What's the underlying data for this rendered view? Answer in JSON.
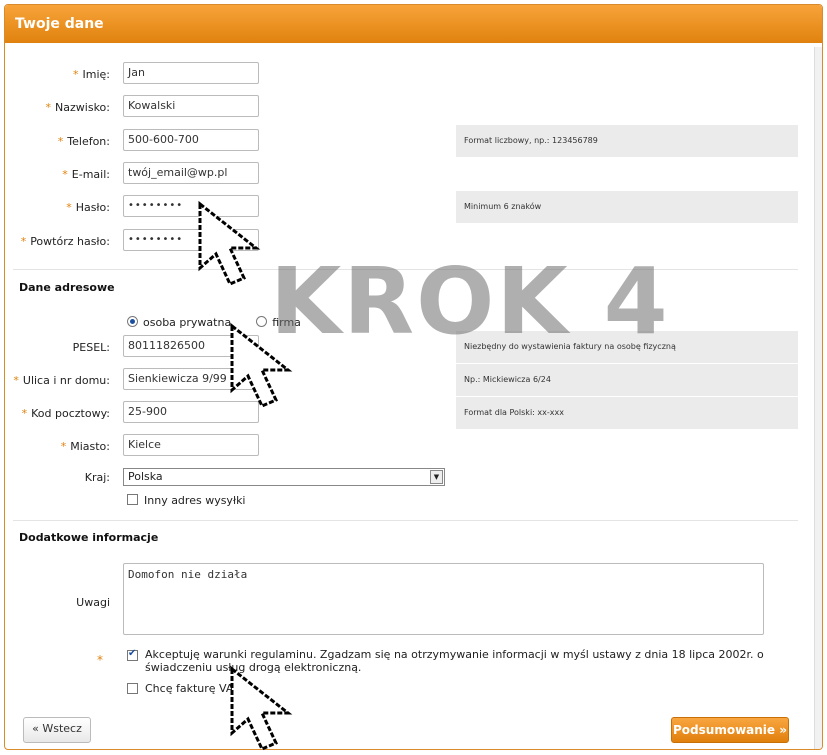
{
  "header": {
    "title": "Twoje dane"
  },
  "personal": {
    "first_name": {
      "label": "Imię:",
      "value": "Jan"
    },
    "last_name": {
      "label": "Nazwisko:",
      "value": "Kowalski"
    },
    "phone": {
      "label": "Telefon:",
      "value": "500-600-700",
      "hint": "Format liczbowy, np.: 123456789"
    },
    "email": {
      "label": "E-mail:",
      "value": "twój_email@wp.pl"
    },
    "password": {
      "label": "Hasło:",
      "value": "••••••••",
      "hint": "Minimum 6 znaków"
    },
    "password_repeat": {
      "label": "Powtórz hasło:",
      "value": "••••••••"
    }
  },
  "address": {
    "section_title": "Dane adresowe",
    "type_private": "osoba prywatna",
    "type_company": "firma",
    "pesel": {
      "label": "PESEL:",
      "value": "80111826500",
      "hint": "Niezbędny do wystawienia faktury na osobę fizyczną"
    },
    "street": {
      "label": "Ulica i nr domu:",
      "value": "Sienkiewicza 9/99",
      "hint": "Np.: Mickiewicza 6/24"
    },
    "postcode": {
      "label": "Kod pocztowy:",
      "value": "25-900",
      "hint": "Format dla Polski: xx-xxx"
    },
    "city": {
      "label": "Miasto:",
      "value": "Kielce"
    },
    "country": {
      "label": "Kraj:",
      "value": "Polska"
    },
    "other_address": "Inny adres wysyłki"
  },
  "extra": {
    "section_title": "Dodatkowe informacje",
    "notes_label": "Uwagi",
    "notes_value": "Domofon nie działa",
    "accept_text": "Akceptuję warunki regulaminu. Zgadzam się na otrzymywanie informacji w myśl ustawy z dnia 18 lipca 2002r. o świadczeniu usług drogą elektroniczną.",
    "invoice_text": "Chcę fakturę VAT"
  },
  "buttons": {
    "back": "« Wstecz",
    "next": "Podsumowanie »"
  },
  "watermark": "KROK 4",
  "colors": {
    "accent": "#e0820e",
    "hint_bg": "#ebebeb"
  }
}
